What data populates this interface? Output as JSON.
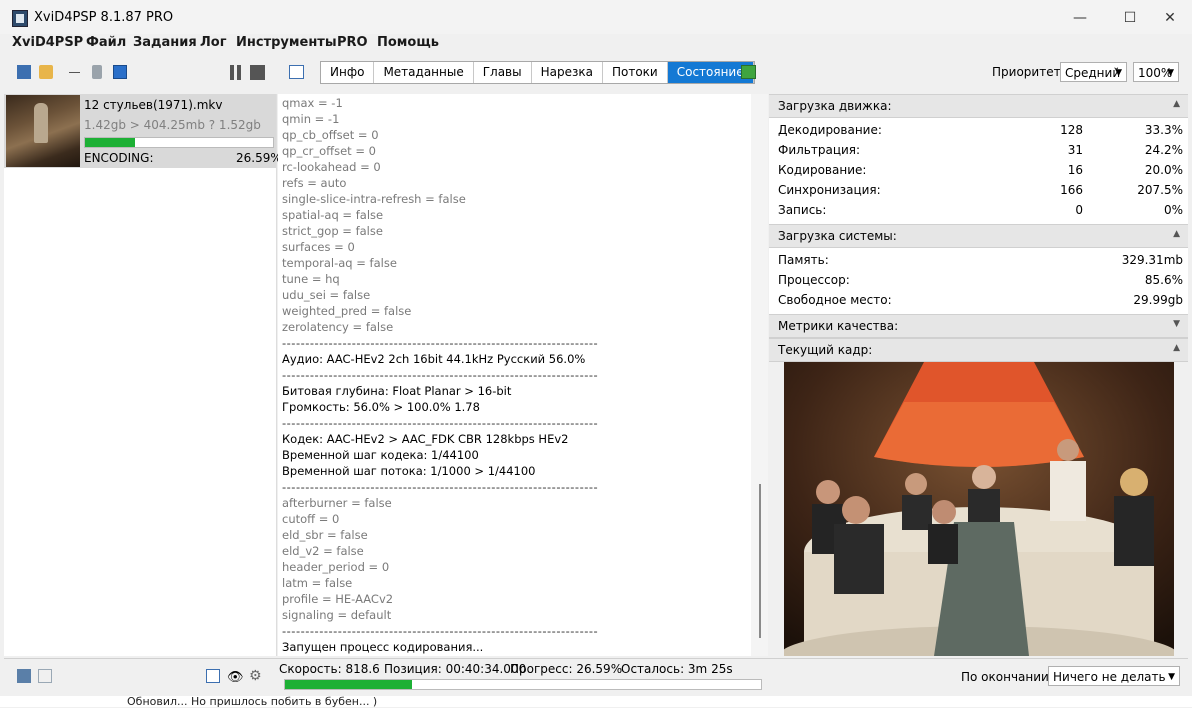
{
  "window": {
    "title": "XviD4PSP 8.1.87 PRO",
    "minimize": "—",
    "maximize": "☐",
    "close": "✕"
  },
  "menu": [
    "XviD4PSP",
    "Файл",
    "Задания",
    "Лог",
    "Инструменты",
    "PRO",
    "Помощь"
  ],
  "toolbar": {
    "tabs": [
      "Инфо",
      "Метаданные",
      "Главы",
      "Нарезка",
      "Потоки",
      "Состояние"
    ],
    "active_tab": "Состояние",
    "priority_label": "Приоритет:",
    "priority_value": "Средний",
    "zoom_value": "100%"
  },
  "task": {
    "name": "12 стульев(1971).mkv",
    "size": "1.42gb > 404.25mb ? 1.52gb",
    "status": "ENCODING:",
    "percent": "26.59%",
    "progress": 0.2659
  },
  "log": [
    {
      "text": "qmax = -1",
      "style": "grey"
    },
    {
      "text": "qmin = -1",
      "style": "grey"
    },
    {
      "text": "qp_cb_offset = 0",
      "style": "grey"
    },
    {
      "text": "qp_cr_offset = 0",
      "style": "grey"
    },
    {
      "text": "rc-lookahead = 0",
      "style": "grey"
    },
    {
      "text": "refs = auto",
      "style": "grey"
    },
    {
      "text": "single-slice-intra-refresh = false",
      "style": "grey"
    },
    {
      "text": "spatial-aq = false",
      "style": "grey"
    },
    {
      "text": "strict_gop = false",
      "style": "grey"
    },
    {
      "text": "surfaces = 0",
      "style": "grey"
    },
    {
      "text": "temporal-aq = false",
      "style": "grey"
    },
    {
      "text": "tune = hq",
      "style": "grey"
    },
    {
      "text": "udu_sei = false",
      "style": "grey"
    },
    {
      "text": "weighted_pred = false",
      "style": "grey"
    },
    {
      "text": "zerolatency = false",
      "style": "grey"
    },
    {
      "text": "--------------------------------------------------------------------",
      "style": "sep"
    },
    {
      "text": "Аудио: AAC-HEv2 2ch 16bit 44.1kHz Русский 56.0%",
      "style": "normal"
    },
    {
      "text": "--------------------------------------------------------------------",
      "style": "sep"
    },
    {
      "text": "Битовая глубина: Float Planar > 16-bit",
      "style": "normal"
    },
    {
      "text": "Громкость: 56.0% > 100.0% 1.78",
      "style": "normal"
    },
    {
      "text": "--------------------------------------------------------------------",
      "style": "sep"
    },
    {
      "text": "Кодек: AAC-HEv2 > AAC_FDK CBR 128kbps HEv2",
      "style": "normal"
    },
    {
      "text": "Временной шаг кодека: 1/44100",
      "style": "normal"
    },
    {
      "text": "Временной шаг потока: 1/1000 > 1/44100",
      "style": "normal"
    },
    {
      "text": "--------------------------------------------------------------------",
      "style": "sep"
    },
    {
      "text": "afterburner = false",
      "style": "grey"
    },
    {
      "text": "cutoff = 0",
      "style": "grey"
    },
    {
      "text": "eld_sbr = false",
      "style": "grey"
    },
    {
      "text": "eld_v2 = false",
      "style": "grey"
    },
    {
      "text": "header_period = 0",
      "style": "grey"
    },
    {
      "text": "latm = false",
      "style": "grey"
    },
    {
      "text": "profile = HE-AACv2",
      "style": "grey"
    },
    {
      "text": "signaling = default",
      "style": "grey"
    },
    {
      "text": "--------------------------------------------------------------------",
      "style": "sep"
    },
    {
      "text": "Запущен процесс кодирования...",
      "style": "normal"
    }
  ],
  "engine": {
    "title": "Загрузка движка:",
    "rows": [
      {
        "label": "Декодирование:",
        "num": "128",
        "pct": "33.3%"
      },
      {
        "label": "Фильтрация:",
        "num": "31",
        "pct": "24.2%"
      },
      {
        "label": "Кодирование:",
        "num": "16",
        "pct": "20.0%"
      },
      {
        "label": "Синхронизация:",
        "num": "166",
        "pct": "207.5%"
      },
      {
        "label": "Запись:",
        "num": "0",
        "pct": "0%"
      }
    ]
  },
  "system": {
    "title": "Загрузка системы:",
    "rows": [
      {
        "label": "Память:",
        "value": "329.31mb"
      },
      {
        "label": "Процессор:",
        "value": "85.6%"
      },
      {
        "label": "Свободное место:",
        "value": "29.99gb"
      }
    ]
  },
  "metrics": {
    "title": "Метрики качества:"
  },
  "frame": {
    "title": "Текущий кадр:"
  },
  "status": {
    "speed": "Скорость: 818.6",
    "position": "Позиция: 00:40:34.000",
    "progress_text": "Прогресс: 26.59%",
    "remaining": "Осталось: 3m 25s",
    "progress": 0.2659,
    "on_finish_label": "По окончании:",
    "on_finish_value": "Ничего не делать"
  },
  "bottom_text": "Обновил... Но пришлось побить в бубен... )",
  "colors": {
    "accent": "#1479d4",
    "progress": "#1db035"
  }
}
